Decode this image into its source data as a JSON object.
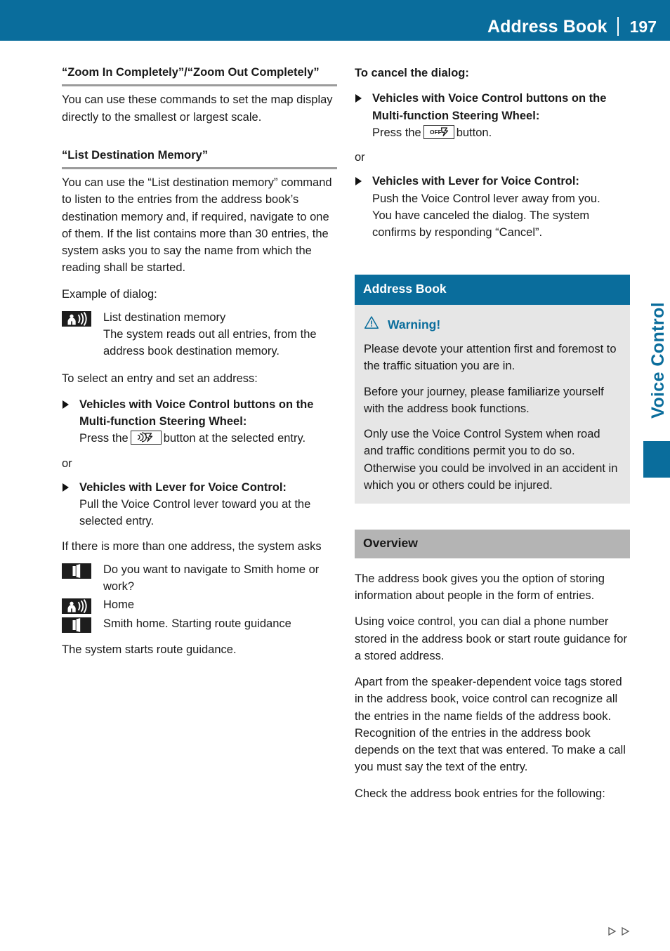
{
  "header": {
    "title": "Address Book",
    "page_number": "197",
    "bar_color": "#0a6d9c"
  },
  "side_tab": {
    "label": "Voice Control",
    "color": "#0a6d9c"
  },
  "left_column": {
    "heading_1": "“Zoom In Completely”/“Zoom Out Completely”",
    "para_1": "You can use these commands to set the map display directly to the smallest or largest scale.",
    "heading_2": "“List Destination Memory”",
    "para_2": "You can use the “List destination memory” command to listen to the entries from the address book’s destination memory and, if required, navigate to one of them. If the list contains more than 30 entries, the system asks you to say the name from which the reading shall be started.",
    "para_3": "Example of dialog:",
    "dialog_1": {
      "icon": "user-speaking-icon",
      "line_1": "List destination memory",
      "line_2": "The system reads out all entries, from the address book destination memory."
    },
    "para_4": "To select an entry and set an address:",
    "bullet_1": {
      "title": "Vehicles with Voice Control buttons on the Multi-function Steering Wheel:",
      "body_before": "Press the",
      "button_icon": "voice-talk-button-icon",
      "body_after": "button at the selected entry."
    },
    "or_1": "or",
    "bullet_2": {
      "title": "Vehicles with Lever for Voice Control:",
      "body": "Pull the Voice Control lever toward you at the selected entry."
    },
    "para_5": "If there is more than one address, the system asks",
    "dialog_2": {
      "icon": "system-speaker-icon",
      "text": "Do you want to navigate to Smith home or work?"
    },
    "dialog_3": {
      "icon": "user-speaking-icon",
      "text": "Home"
    },
    "dialog_4": {
      "icon": "system-speaker-icon",
      "text": "Smith home. Starting route guidance"
    },
    "para_6": "The system starts route guidance."
  },
  "right_column": {
    "heading_1": "To cancel the dialog:",
    "bullet_1": {
      "title": "Vehicles with Voice Control buttons on the Multi-function Steering Wheel:",
      "body_before": "Press the",
      "button_icon": "voice-off-button-icon",
      "button_label": "OFF",
      "body_after": "button."
    },
    "or_1": "or",
    "bullet_2": {
      "title": "Vehicles with Lever for Voice Control:",
      "body_line_1": "Push the Voice Control lever away from you.",
      "body_line_2": "You have canceled the dialog. The system confirms by responding “Cancel”."
    },
    "address_book_section": {
      "title": "Address Book",
      "title_bg": "#0a6d9c",
      "warning": {
        "label": "Warning!",
        "label_color": "#0a6d9c",
        "box_bg": "#e6e6e6",
        "para_1": "Please devote your attention first and foremost to the traffic situation you are in.",
        "para_2": "Before your journey, please familiarize yourself with the address book functions.",
        "para_3": "Only use the Voice Control System when road and traffic conditions permit you to do so. Otherwise you could be involved in an accident in which you or others could be injured."
      }
    },
    "overview_section": {
      "title": "Overview",
      "title_bg": "#b4b4b4",
      "para_1": "The address book gives you the option of storing information about people in the form of entries.",
      "para_2": "Using voice control, you can dial a phone number stored in the address book or start route guidance for a stored address.",
      "para_3": "Apart from the speaker-dependent voice tags stored in the address book, voice control can recognize all the entries in the name fields of the address book. Recognition of the entries in the address book depends on the text that was entered. To make a call you must say the text of the entry.",
      "para_4": "Check the address book entries for the following:"
    }
  },
  "footer": {
    "continuation_marker": "▷▷"
  }
}
